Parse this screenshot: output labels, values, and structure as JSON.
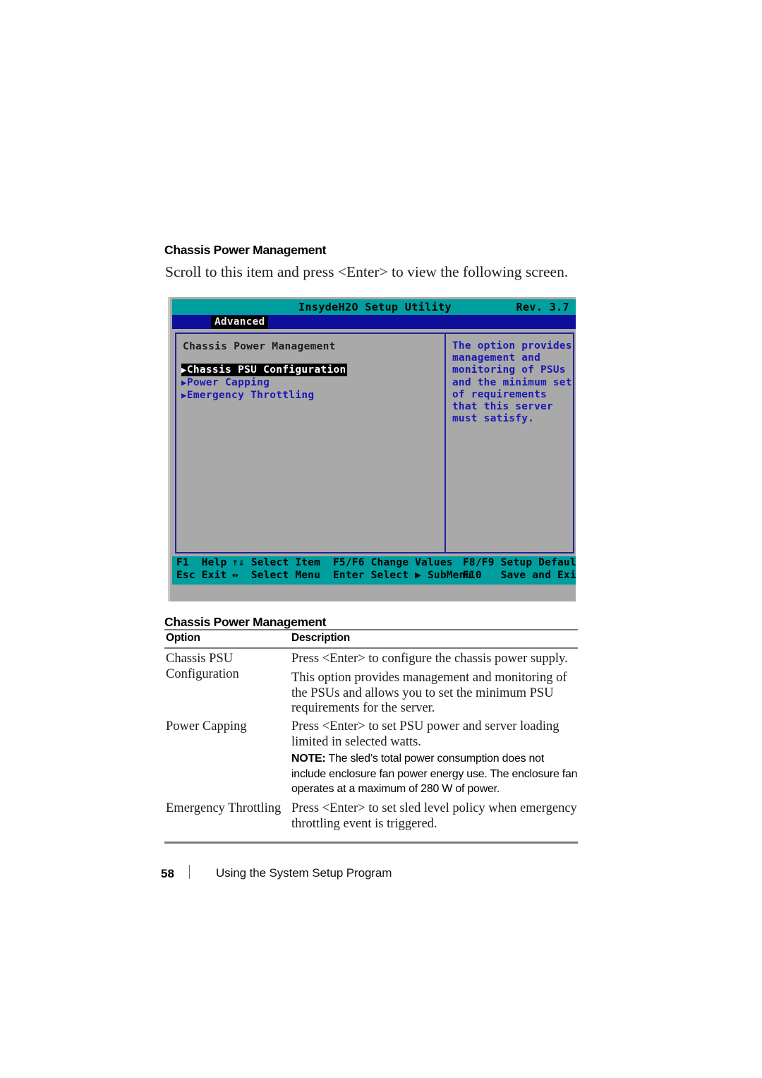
{
  "section": {
    "heading": "Chassis Power Management",
    "lead": "Scroll to this item and press <Enter> to view the following screen."
  },
  "bios": {
    "title": "InsydeH2O Setup Utility",
    "revision": "Rev. 3.7",
    "active_menu": "Advanced",
    "pane_title": "Chassis Power Management",
    "items": [
      {
        "label": "Chassis PSU Configuration",
        "selected": true
      },
      {
        "label": "Power Capping",
        "selected": false
      },
      {
        "label": "Emergency Throttling",
        "selected": false
      }
    ],
    "help_text": "The option provides management and monitoring of PSUs and the minimum set of requirements that this server must satisfy.",
    "footer": {
      "row1": [
        {
          "key": "F1",
          "action": "Help"
        },
        {
          "key": "⇑⇓",
          "action": "Select Item"
        },
        {
          "key": "F5/F6",
          "action": "Change Values"
        },
        {
          "key": "F8/F9",
          "action": "Setup Defaults"
        }
      ],
      "row2": [
        {
          "key": "Esc",
          "action": "Exit"
        },
        {
          "key": "⇔",
          "action": "Select Menu"
        },
        {
          "key": "Enter",
          "action": "Select ▶ SubMenu"
        },
        {
          "key": "F10",
          "action": "Save and Exit"
        }
      ]
    },
    "colors": {
      "titlebar": "#009e9e",
      "menubar": "#0f0f9c",
      "panel_bg": "#a9a9a9",
      "panel_border": "#20209c",
      "item_text": "#1a1ab4",
      "selected_bg": "#000000",
      "selected_text": "#ffffff"
    }
  },
  "table": {
    "title": "Chassis Power Management",
    "headers": {
      "option": "Option",
      "description": "Description"
    },
    "rows": [
      {
        "option": "Chassis PSU Configuration",
        "desc1": "Press <Enter> to configure the chassis power supply.",
        "desc2": "This option provides management and monitoring of the PSUs and allows you to set the minimum PSU requirements for the server."
      },
      {
        "option": "Power Capping",
        "desc1": "Press <Enter> to set PSU power and server loading limited in selected watts.",
        "note_lead": "NOTE:",
        "note_body": " The sled’s total power consumption does not include enclosure fan power energy use. The enclosure fan operates at a maximum of 280 W of power."
      },
      {
        "option": "Emergency Throttling",
        "desc1": "Press <Enter> to set sled level policy when emergency throttling event is triggered."
      }
    ]
  },
  "footer": {
    "page_number": "58",
    "running_head": "Using the System Setup Program"
  }
}
